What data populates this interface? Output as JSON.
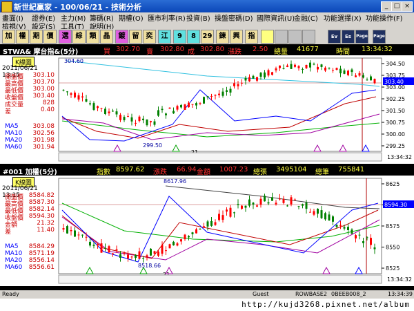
{
  "window": {
    "title": "新世紀贏家 - 100/06/21 - 技術分析"
  },
  "menu": [
    "畫面(I)",
    "證券(E)",
    "主力(M)",
    "籌碼(R)",
    "期權(O)",
    "匯市利率(R)",
    "投資(B)",
    "操盤密碼(D)",
    "國際資訊(U)",
    "金融(C)",
    "功能選擇(X)",
    "功能操作(F)",
    "檢視(V)",
    "設定(S)",
    "工具(T)",
    "說明(H)"
  ],
  "toolbar": [
    "加",
    "權",
    "期",
    "價",
    "選",
    "綜",
    "類",
    "晶",
    "鍍",
    "留",
    "奕",
    "江",
    "9",
    "8",
    "29",
    "鍊",
    "興",
    "指"
  ],
  "toolbar_right": [
    "Ev",
    "Es",
    "Page",
    "Page"
  ],
  "colors": {
    "up": "#ff0000",
    "down": "#008000",
    "ma5": "#0000ff",
    "ma10": "#c00000",
    "ma20": "#a000a0",
    "ma60": "#00b000"
  },
  "chart1": {
    "header": {
      "symbol": "STWA& 摩台指&(5分)",
      "buy_label": "買",
      "buy": "302.70",
      "sell_label": "賣",
      "sell": "302.80",
      "deal_label": "成",
      "deal": "302.80",
      "change_label": "漲跌",
      "change": "2.50",
      "volume_label": "總量",
      "volume": "41677",
      "time_label": "時間",
      "time": "13:34:32"
    },
    "tag": "K線圖",
    "date": "2011/06/21 13:15",
    "info": [
      {
        "k": "開盤價",
        "v": "303.10"
      },
      {
        "k": "最高價",
        "v": "303.70"
      },
      {
        "k": "最低價",
        "v": "303.00"
      },
      {
        "k": "收盤價",
        "v": "303.40"
      },
      {
        "k": "成交量",
        "v": "828"
      },
      {
        "k": "差",
        "v": "0.40"
      }
    ],
    "ma": [
      {
        "k": "MA5",
        "v": "303.08"
      },
      {
        "k": "MA10",
        "v": "302.56"
      },
      {
        "k": "MA20",
        "v": "301.98"
      },
      {
        "k": "MA60",
        "v": "301.94"
      }
    ],
    "yticks": [
      "304.50",
      "303.75",
      "303.00",
      "302.25",
      "301.50",
      "300.75",
      "300.00",
      "299.25"
    ],
    "price_box": "303.40",
    "high_label": "304.60",
    "low_label": "299.50",
    "day_label": "21",
    "bottom_time": "13:34:32"
  },
  "chart2": {
    "header": {
      "symbol": "#001 加權(5分)",
      "index_label": "指數",
      "index": "8597.62",
      "change_label": "漲跌",
      "change": "66.94",
      "amount_label": "金額",
      "amount": "1007.23",
      "volume_label": "總張",
      "volume": "3495104",
      "count_label": "總筆",
      "count": "755841"
    },
    "tag": "K線圖",
    "date": "2011/06/21 13:15",
    "info": [
      {
        "k": "開盤價",
        "v": "8584.82"
      },
      {
        "k": "最高價",
        "v": "8587.30"
      },
      {
        "k": "最低價",
        "v": "8582.14"
      },
      {
        "k": "收盤價",
        "v": "8594.30"
      },
      {
        "k": "金額",
        "v": "21.32"
      },
      {
        "k": "差",
        "v": "11.40"
      }
    ],
    "ma": [
      {
        "k": "MA5",
        "v": "8584.29"
      },
      {
        "k": "MA10",
        "v": "8571.19"
      },
      {
        "k": "MA20",
        "v": "8556.14"
      },
      {
        "k": "MA60",
        "v": "8556.61"
      }
    ],
    "yticks": [
      "8625",
      "8600",
      "8575",
      "8550",
      "8525"
    ],
    "price_box": "8594.30",
    "high_label": "8617.96",
    "low_label": "8518.66",
    "day_label": "21",
    "bottom_time": "13:34:32"
  },
  "status": {
    "ready": "Ready",
    "user": "Guest",
    "base": "ROWBASE2",
    "code": "0BEEB008_2",
    "time": "13:34:39"
  },
  "footer_url": "http://kujd3268.pixnet.net/album"
}
